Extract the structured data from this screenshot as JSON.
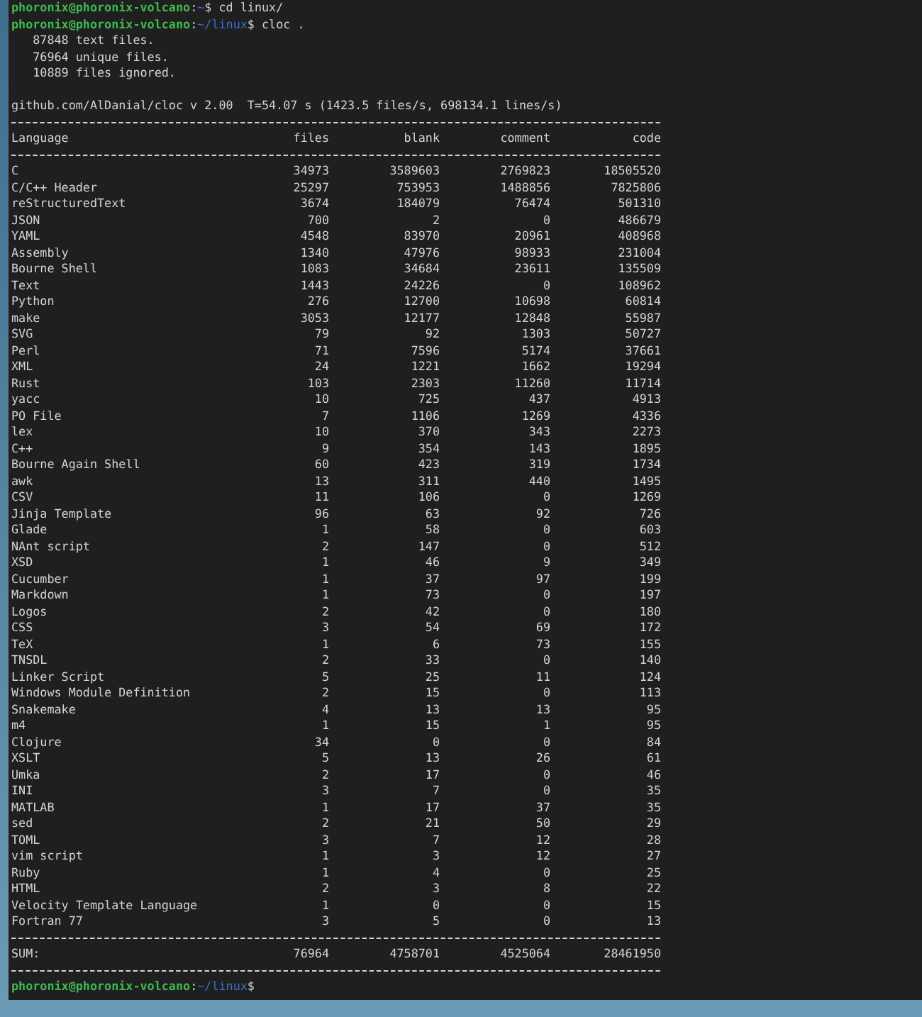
{
  "terminal": {
    "previous_command": {
      "user_host": "phoronix@phoronix-volcano",
      "separator": ":",
      "path": "~",
      "symbol": "$",
      "command": "cd linux/"
    },
    "command": {
      "user_host": "phoronix@phoronix-volcano",
      "separator": ":",
      "path": "~/linux",
      "symbol": "$",
      "command": "cloc ."
    },
    "summary": [
      "   87848 text files.",
      "   76964 unique files.",
      "   10889 files ignored."
    ],
    "header": "github.com/AlDanial/cloc v 2.00  T=54.07 s (1423.5 files/s, 698134.1 lines/s)",
    "table": {
      "columns": [
        "Language",
        "files",
        "blank",
        "comment",
        "code"
      ],
      "rows": [
        [
          "C",
          "34973",
          "3589603",
          "2769823",
          "18505520"
        ],
        [
          "C/C++ Header",
          "25297",
          "753953",
          "1488856",
          "7825806"
        ],
        [
          "reStructuredText",
          "3674",
          "184079",
          "76474",
          "501310"
        ],
        [
          "JSON",
          "700",
          "2",
          "0",
          "486679"
        ],
        [
          "YAML",
          "4548",
          "83970",
          "20961",
          "408968"
        ],
        [
          "Assembly",
          "1340",
          "47976",
          "98933",
          "231004"
        ],
        [
          "Bourne Shell",
          "1083",
          "34684",
          "23611",
          "135509"
        ],
        [
          "Text",
          "1443",
          "24226",
          "0",
          "108962"
        ],
        [
          "Python",
          "276",
          "12700",
          "10698",
          "60814"
        ],
        [
          "make",
          "3053",
          "12177",
          "12848",
          "55987"
        ],
        [
          "SVG",
          "79",
          "92",
          "1303",
          "50727"
        ],
        [
          "Perl",
          "71",
          "7596",
          "5174",
          "37661"
        ],
        [
          "XML",
          "24",
          "1221",
          "1662",
          "19294"
        ],
        [
          "Rust",
          "103",
          "2303",
          "11260",
          "11714"
        ],
        [
          "yacc",
          "10",
          "725",
          "437",
          "4913"
        ],
        [
          "PO File",
          "7",
          "1106",
          "1269",
          "4336"
        ],
        [
          "lex",
          "10",
          "370",
          "343",
          "2273"
        ],
        [
          "C++",
          "9",
          "354",
          "143",
          "1895"
        ],
        [
          "Bourne Again Shell",
          "60",
          "423",
          "319",
          "1734"
        ],
        [
          "awk",
          "13",
          "311",
          "440",
          "1495"
        ],
        [
          "CSV",
          "11",
          "106",
          "0",
          "1269"
        ],
        [
          "Jinja Template",
          "96",
          "63",
          "92",
          "726"
        ],
        [
          "Glade",
          "1",
          "58",
          "0",
          "603"
        ],
        [
          "NAnt script",
          "2",
          "147",
          "0",
          "512"
        ],
        [
          "XSD",
          "1",
          "46",
          "9",
          "349"
        ],
        [
          "Cucumber",
          "1",
          "37",
          "97",
          "199"
        ],
        [
          "Markdown",
          "1",
          "73",
          "0",
          "197"
        ],
        [
          "Logos",
          "2",
          "42",
          "0",
          "180"
        ],
        [
          "CSS",
          "3",
          "54",
          "69",
          "172"
        ],
        [
          "TeX",
          "1",
          "6",
          "73",
          "155"
        ],
        [
          "TNSDL",
          "2",
          "33",
          "0",
          "140"
        ],
        [
          "Linker Script",
          "5",
          "25",
          "11",
          "124"
        ],
        [
          "Windows Module Definition",
          "2",
          "15",
          "0",
          "113"
        ],
        [
          "Snakemake",
          "4",
          "13",
          "13",
          "95"
        ],
        [
          "m4",
          "1",
          "15",
          "1",
          "95"
        ],
        [
          "Clojure",
          "34",
          "0",
          "0",
          "84"
        ],
        [
          "XSLT",
          "5",
          "13",
          "26",
          "61"
        ],
        [
          "Umka",
          "2",
          "17",
          "0",
          "46"
        ],
        [
          "INI",
          "3",
          "7",
          "0",
          "35"
        ],
        [
          "MATLAB",
          "1",
          "17",
          "37",
          "35"
        ],
        [
          "sed",
          "2",
          "21",
          "50",
          "29"
        ],
        [
          "TOML",
          "3",
          "7",
          "12",
          "28"
        ],
        [
          "vim script",
          "1",
          "3",
          "12",
          "27"
        ],
        [
          "Ruby",
          "1",
          "4",
          "0",
          "25"
        ],
        [
          "HTML",
          "2",
          "3",
          "8",
          "22"
        ],
        [
          "Velocity Template Language",
          "1",
          "0",
          "0",
          "15"
        ],
        [
          "Fortran 77",
          "3",
          "5",
          "0",
          "13"
        ]
      ],
      "sum": [
        "SUM:",
        "76964",
        "4758701",
        "4525064",
        "28461950"
      ]
    },
    "prompt": {
      "user_host": "phoronix@phoronix-volcano",
      "separator": ":",
      "path": "~/linux",
      "symbol": "$"
    }
  }
}
